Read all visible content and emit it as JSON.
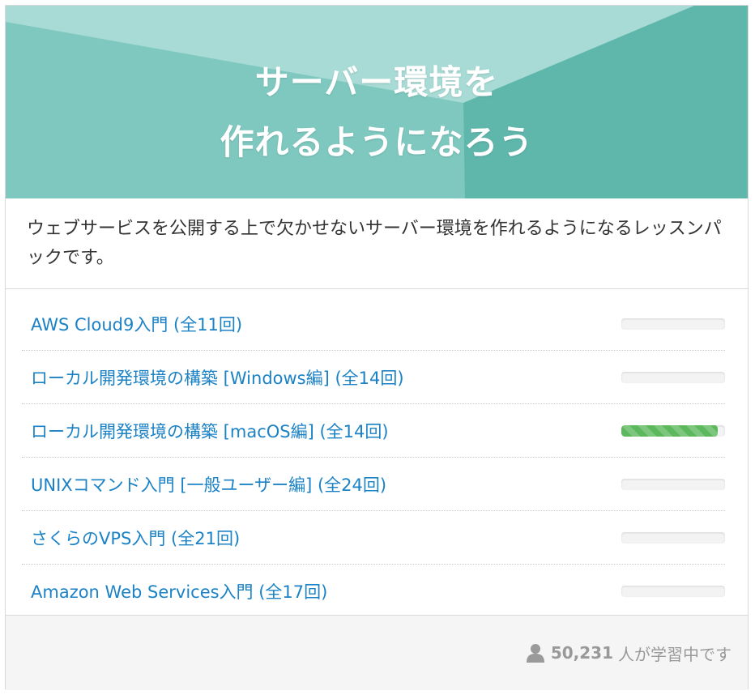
{
  "hero": {
    "title_line1": "サーバー環境を",
    "title_line2": "作れるようになろう",
    "colors": {
      "left_light": "#a8dbd5",
      "mid": "#7ec8bf",
      "right_dark": "#5fb7ac"
    }
  },
  "description": "ウェブサービスを公開する上で欠かせないサーバー環境を作れるようになるレッスンパックです。",
  "lessons": [
    {
      "label": "AWS Cloud9入門 (全11回)",
      "progress": 0
    },
    {
      "label": "ローカル開発環境の構築 [Windows編] (全14回)",
      "progress": 0
    },
    {
      "label": "ローカル開発環境の構築 [macOS編] (全14回)",
      "progress": 0.93
    },
    {
      "label": "UNIXコマンド入門 [一般ユーザー編] (全24回)",
      "progress": 0
    },
    {
      "label": "さくらのVPS入門 (全21回)",
      "progress": 0
    },
    {
      "label": "Amazon Web Services入門 (全17回)",
      "progress": 0
    }
  ],
  "footer": {
    "icon": "person-icon",
    "learner_count": "50,231",
    "learner_text": "人が学習中です"
  },
  "colors": {
    "link": "#1b82c5",
    "progress_fill": "#5cb85c"
  }
}
